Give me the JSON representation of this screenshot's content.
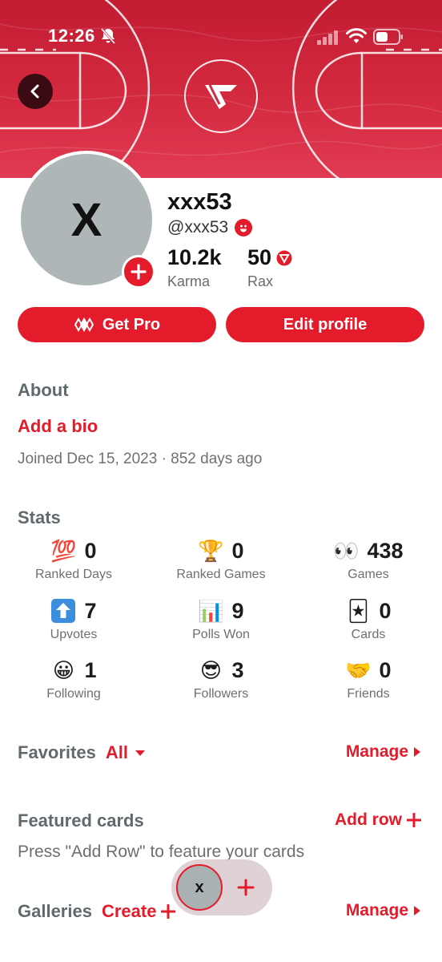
{
  "status_bar": {
    "time": "12:26"
  },
  "profile": {
    "avatar_letter": "X",
    "username": "xxx53",
    "handle": "@xxx53",
    "karma_value": "10.2k",
    "karma_label": "Karma",
    "rax_value": "50",
    "rax_label": "Rax"
  },
  "actions": {
    "get_pro": "Get Pro",
    "edit_profile": "Edit profile"
  },
  "about": {
    "title": "About",
    "add_bio": "Add a bio",
    "joined": "Joined Dec 15, 2023 · 852 days ago"
  },
  "stats": {
    "title": "Stats",
    "items": [
      {
        "emoji": "💯",
        "value": "0",
        "label": "Ranked Days"
      },
      {
        "emoji": "🏆",
        "value": "0",
        "label": "Ranked Games"
      },
      {
        "emoji": "👀",
        "value": "438",
        "label": "Games"
      },
      {
        "emoji": "⬆",
        "value": "7",
        "label": "Upvotes"
      },
      {
        "emoji": "📊",
        "value": "9",
        "label": "Polls Won"
      },
      {
        "emoji": "🃏",
        "value": "0",
        "label": "Cards"
      },
      {
        "emoji": "😀",
        "value": "1",
        "label": "Following"
      },
      {
        "emoji": "😎",
        "value": "3",
        "label": "Followers"
      },
      {
        "emoji": "🤝",
        "value": "0",
        "label": "Friends"
      }
    ]
  },
  "favorites": {
    "title": "Favorites",
    "filter": "All",
    "manage": "Manage"
  },
  "featured": {
    "title": "Featured cards",
    "add_row": "Add row",
    "hint": "Press \"Add Row\" to feature your cards"
  },
  "galleries": {
    "title": "Galleries",
    "create": "Create",
    "manage": "Manage"
  },
  "fab": {
    "avatar_letter": "x"
  },
  "colors": {
    "accent": "#e31b2b",
    "banner": "#c21c32",
    "avatar_bg": "#aeb6b8",
    "section_title": "#606a6e"
  }
}
